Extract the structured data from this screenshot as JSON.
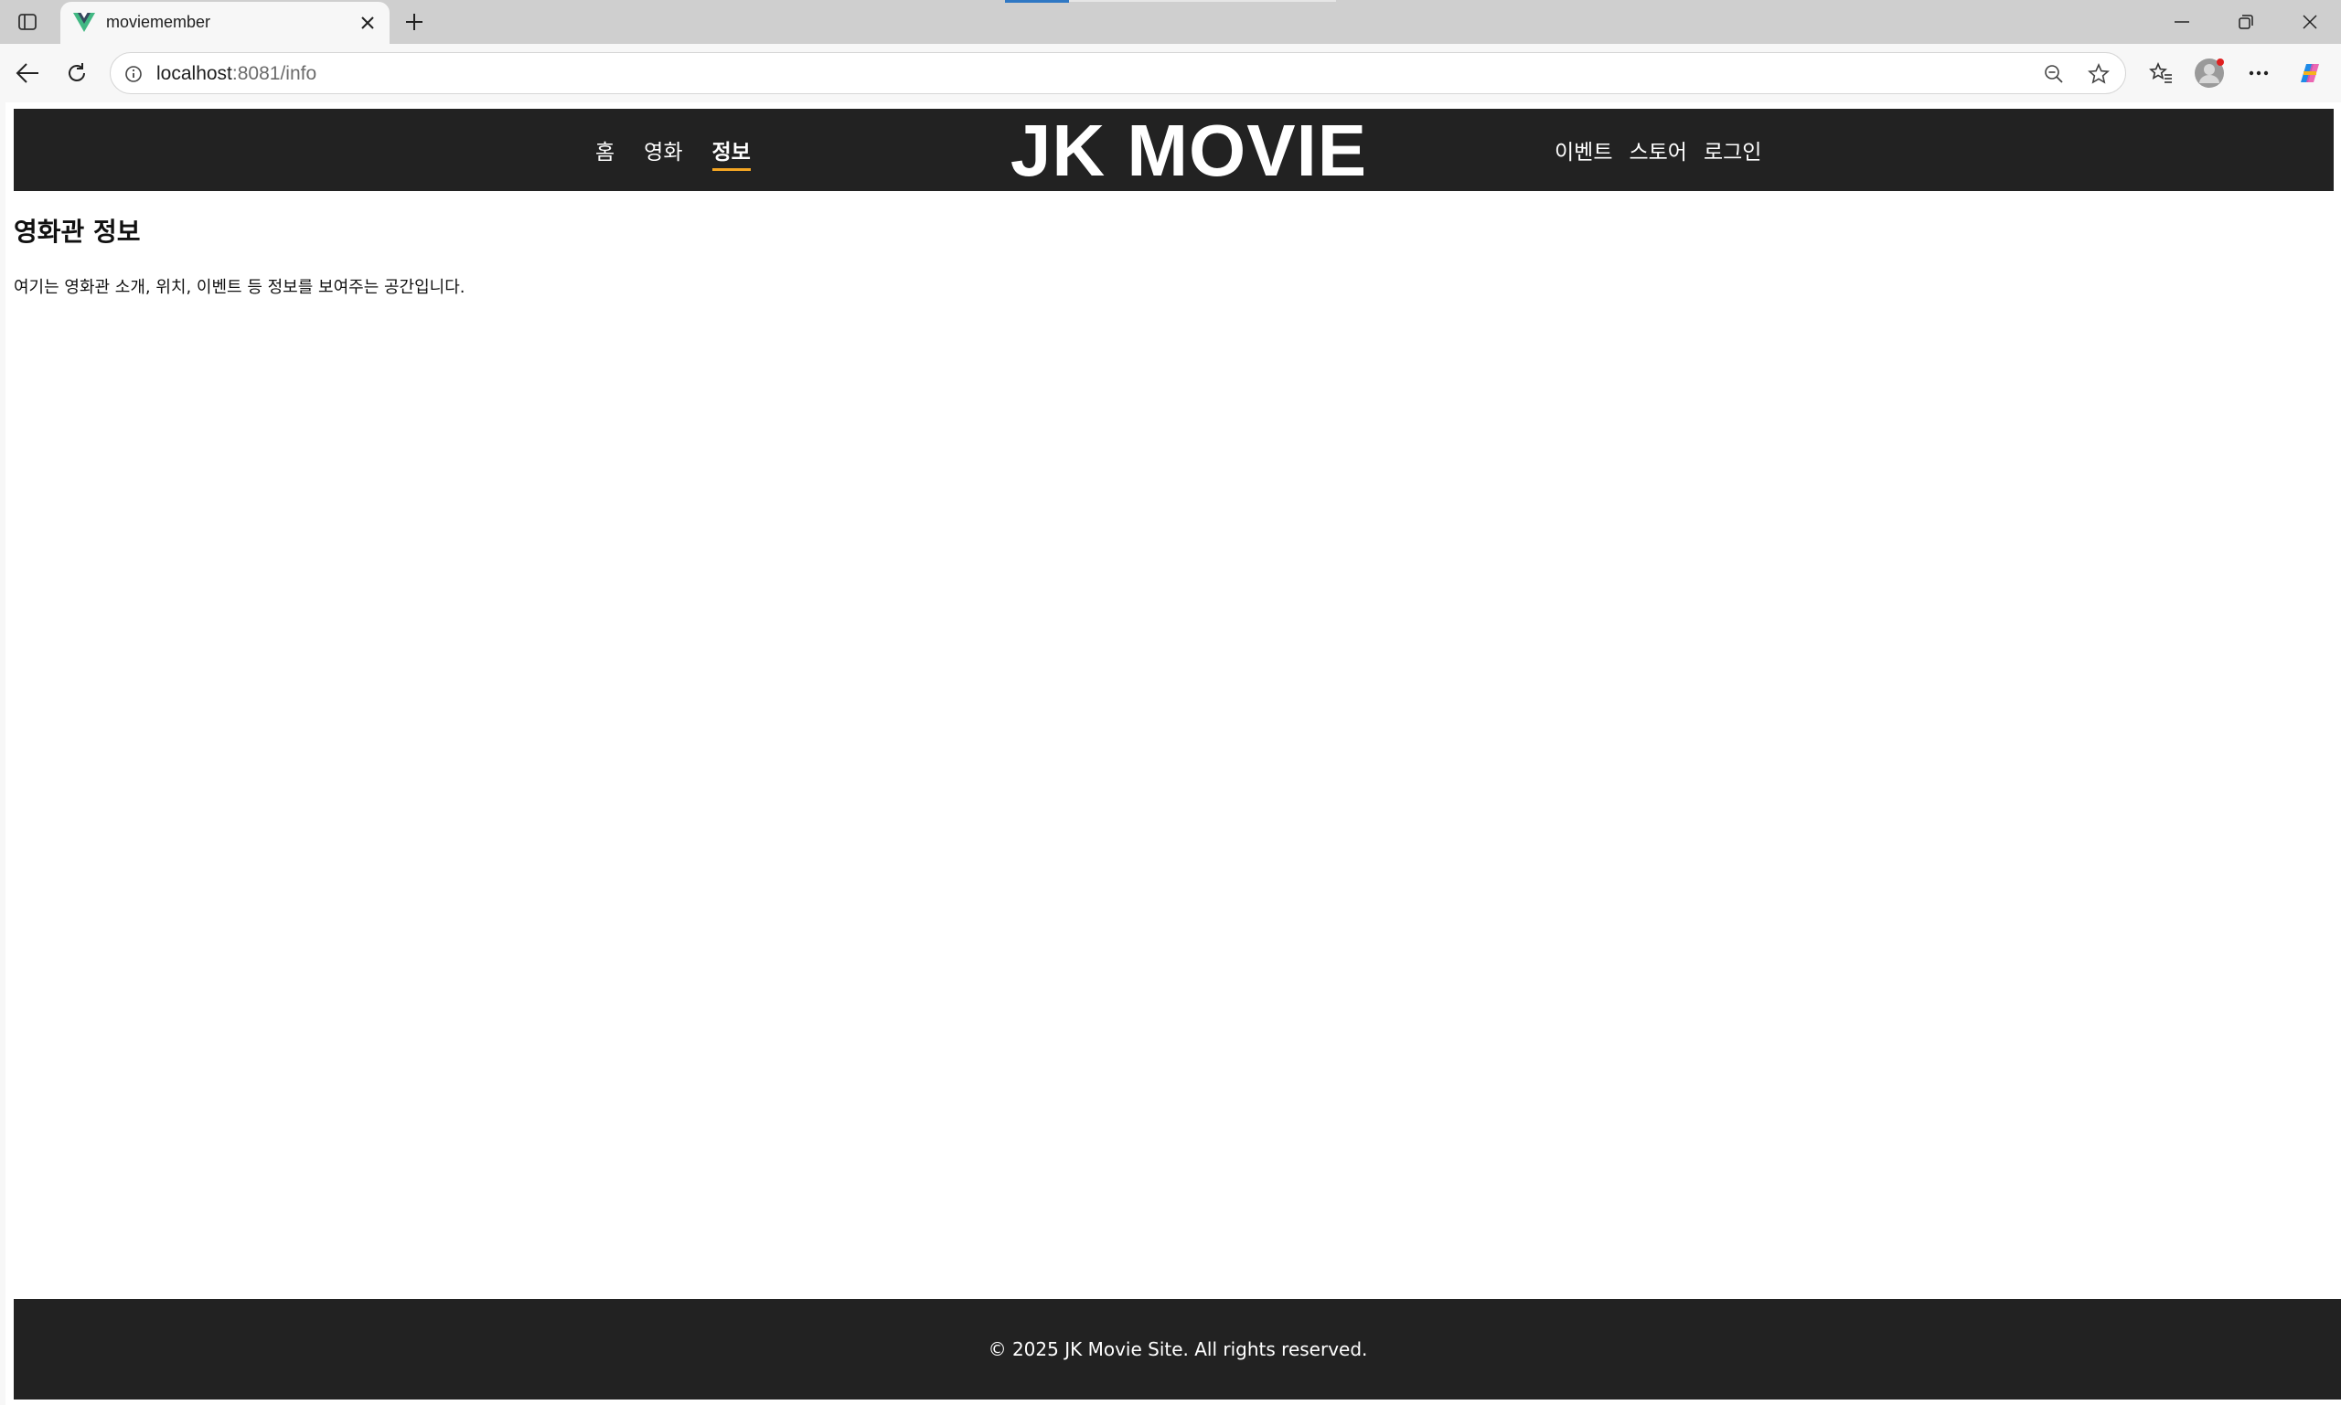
{
  "browser": {
    "tab_title": "moviemember",
    "url_host": "localhost",
    "url_rest": ":8081/info"
  },
  "icons": {
    "tab_actions": "tab-actions-icon",
    "favicon": "vue-logo-icon",
    "close": "close-icon",
    "new_tab": "plus-icon",
    "back": "back-arrow-icon",
    "reload": "reload-icon",
    "info": "info-icon",
    "zoom": "zoom-out-icon",
    "favorite": "star-icon",
    "favorites": "favorites-icon",
    "profile": "avatar-icon",
    "more": "more-icon",
    "copilot": "copilot-icon"
  },
  "site": {
    "logo": "JK MOVIE",
    "nav_left": [
      {
        "label": "홈",
        "active": false
      },
      {
        "label": "영화",
        "active": false
      },
      {
        "label": "정보",
        "active": true
      }
    ],
    "nav_right": [
      {
        "label": "이벤트"
      },
      {
        "label": "스토어"
      },
      {
        "label": "로그인"
      }
    ],
    "accent_color": "#f5a623",
    "header_color": "#222222"
  },
  "main": {
    "title": "영화관 정보",
    "description": "여기는 영화관 소개, 위치, 이벤트 등 정보를 보여주는 공간입니다."
  },
  "footer": {
    "text": "© 2025 JK Movie Site. All rights reserved."
  }
}
